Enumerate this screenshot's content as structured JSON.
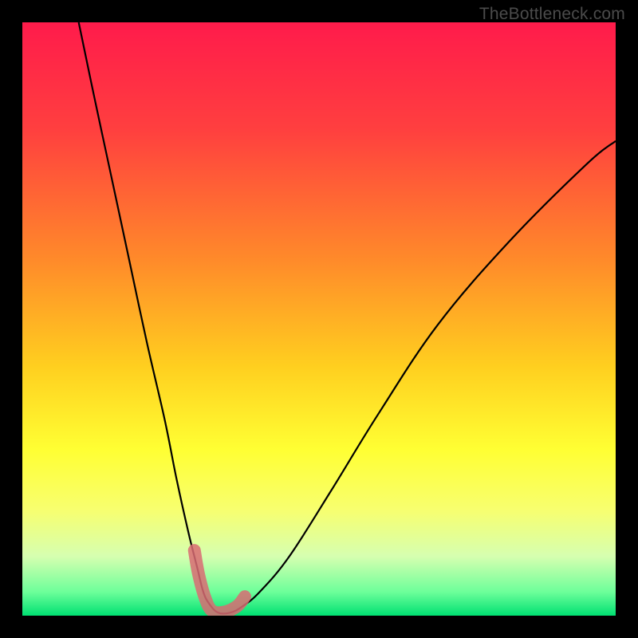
{
  "watermark": "TheBottleneck.com",
  "chart_data": {
    "type": "line",
    "title": "",
    "xlabel": "",
    "ylabel": "",
    "xlim": [
      0,
      100
    ],
    "ylim": [
      0,
      100
    ],
    "gradient_stops": [
      {
        "offset": 0.0,
        "color": "#ff1b4b"
      },
      {
        "offset": 0.18,
        "color": "#ff3f3f"
      },
      {
        "offset": 0.4,
        "color": "#ff8a2a"
      },
      {
        "offset": 0.58,
        "color": "#ffcf1f"
      },
      {
        "offset": 0.72,
        "color": "#ffff33"
      },
      {
        "offset": 0.82,
        "color": "#f8ff6e"
      },
      {
        "offset": 0.9,
        "color": "#d6ffb0"
      },
      {
        "offset": 0.96,
        "color": "#6dff9a"
      },
      {
        "offset": 1.0,
        "color": "#00e072"
      }
    ],
    "series": [
      {
        "name": "bottleneck-curve",
        "stroke": "#000000",
        "x": [
          9.5,
          12,
          15,
          18,
          21,
          24,
          26,
          28,
          29.5,
          30.5,
          31.5,
          33,
          35,
          37,
          40,
          45,
          52,
          60,
          70,
          82,
          95,
          100
        ],
        "y": [
          100,
          88,
          74,
          60,
          46,
          33,
          23,
          14,
          8,
          4,
          2,
          0.5,
          0.5,
          1.5,
          4,
          10,
          21,
          34,
          49,
          63,
          76,
          80
        ]
      },
      {
        "name": "highlight-band",
        "stroke": "#d96b73",
        "x": [
          29,
          29.7,
          30.8,
          32,
          34,
          36.2,
          37.5
        ],
        "y": [
          11,
          7,
          3,
          0.8,
          0.6,
          1.6,
          3.2
        ]
      }
    ]
  }
}
